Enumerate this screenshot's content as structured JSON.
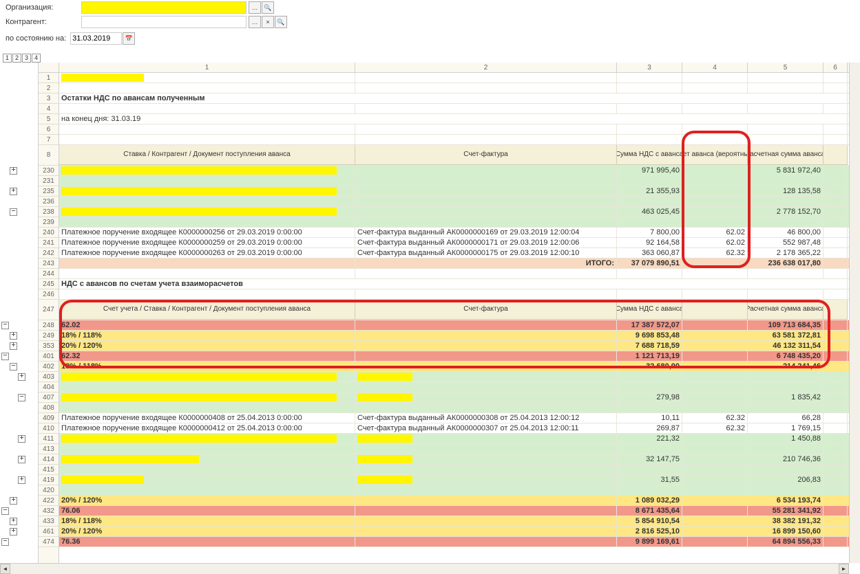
{
  "controls": {
    "org_label": "Организация:",
    "contr_label": "Контрагент:",
    "date_label": "по состоянию на:",
    "date_value": "31.03.2019",
    "btn_dots": "…",
    "btn_x": "×",
    "btn_search": "🔍",
    "btn_cal": "📅"
  },
  "outline": [
    "1",
    "2",
    "3",
    "4"
  ],
  "cols": [
    "1",
    "2",
    "3",
    "4",
    "5",
    "6"
  ],
  "title": "Остатки НДС по авансам полученным",
  "subtitle": "на конец дня: 31.03.19",
  "hdr1": {
    "c1": "Ставка / Контрагент / Документ поступления аванса",
    "c2": "Счет-фактура",
    "c3": "Сумма НДС с аванса",
    "c4": "Счет аванса (вероятный)",
    "c5": "Расчетная сумма аванса"
  },
  "rows1": [
    {
      "n": "230",
      "cls": "bg-green",
      "c1r": "rw2",
      "c3": "971 995,40",
      "c5": "5 831 972,40"
    },
    {
      "n": "231",
      "cls": "bg-green"
    },
    {
      "n": "235",
      "cls": "bg-green",
      "c1r": "rw2",
      "c3": "21 355,93",
      "c5": "128 135,58"
    },
    {
      "n": "236",
      "cls": "bg-green"
    },
    {
      "n": "238",
      "cls": "bg-green",
      "c1r": "rw2",
      "c3": "463 025,45",
      "c5": "2 778 152,70"
    },
    {
      "n": "239",
      "cls": "bg-green"
    },
    {
      "n": "240",
      "c1": "Платежное поручение входящее К0000000256 от 29.03.2019 0:00:00",
      "c2": "Счет-фактура выданный АК0000000169 от 29.03.2019 12:00:04",
      "c3": "7 800,00",
      "c4": "62.02",
      "c5": "46 800,00"
    },
    {
      "n": "241",
      "c1": "Платежное поручение входящее К0000000259 от 29.03.2019 0:00:00",
      "c2": "Счет-фактура выданный АК0000000171 от 29.03.2019 12:00:06",
      "c3": "92 164,58",
      "c4": "62.02",
      "c5": "552 987,48"
    },
    {
      "n": "242",
      "c1": "Платежное поручение входящее К0000000263 от 29.03.2019 0:00:00",
      "c2": "Счет-фактура выданный АК0000000175 от 29.03.2019 12:00:10",
      "c3": "363 060,87",
      "c4": "62.32",
      "c5": "2 178 365,22"
    },
    {
      "n": "243",
      "cls": "bg-salmon bold",
      "c2r": "ИТОГО:",
      "c3": "37 079 890,51",
      "c5": "236 638 017,80"
    }
  ],
  "title2": "НДС с авансов по счетам учета взаиморасчетов",
  "hdr2": {
    "c1": "Счет учета / Ставка / Контрагент / Документ поступления аванса",
    "c2": "Счет-фактура",
    "c3": "Сумма НДС с аванса",
    "c5": "Расчетная сумма аванса"
  },
  "rows2": [
    {
      "n": "248",
      "cls": "bg-red bold",
      "c1": "62.02",
      "c3": "17 387 572,07",
      "c5": "109 713 684,35"
    },
    {
      "n": "249",
      "cls": "bg-yel bold",
      "c1": "18% / 118%",
      "c3": "9 698 853,48",
      "c5": "63 581 372,81"
    },
    {
      "n": "353",
      "cls": "bg-yel bold",
      "c1": "20% / 120%",
      "c3": "7 688 718,59",
      "c5": "46 132 311,54"
    },
    {
      "n": "401",
      "cls": "bg-red bold",
      "c1": "62.32",
      "c3": "1 121 713,19",
      "c5": "6 748 435,20"
    },
    {
      "n": "402",
      "cls": "bg-yel bold",
      "c1": "18% / 118%",
      "c3": "32 680,90",
      "c5": "214 241,46"
    },
    {
      "n": "403",
      "cls": "bg-green",
      "c1r": "rw2",
      "c2r2": "rw4"
    },
    {
      "n": "404",
      "cls": "bg-green"
    },
    {
      "n": "407",
      "cls": "bg-green",
      "c1r": "rw2",
      "c2r2": "rw4",
      "c3": "279,98",
      "c5": "1 835,42"
    },
    {
      "n": "408",
      "cls": "bg-green"
    },
    {
      "n": "409",
      "c1": "Платежное поручение входящее К0000000408 от 25.04.2013 0:00:00",
      "c2": "Счет-фактура выданный АК0000000308 от 25.04.2013 12:00:12",
      "c3": "10,11",
      "c4": "62.32",
      "c5": "66,28"
    },
    {
      "n": "410",
      "c1": "Платежное поручение входящее К0000000412 от 25.04.2013 0:00:00",
      "c2": "Счет-фактура выданный АК0000000307 от 25.04.2013 12:00:11",
      "c3": "269,87",
      "c4": "62.32",
      "c5": "1 769,15"
    },
    {
      "n": "411",
      "cls": "bg-green",
      "c1r": "rw2",
      "c2r2": "rw4",
      "c3": "221,32",
      "c5": "1 450,88"
    },
    {
      "n": "413",
      "cls": "bg-green"
    },
    {
      "n": "414",
      "cls": "bg-green",
      "c1r": "rw1",
      "c2r2": "rw4",
      "c3": "32 147,75",
      "c5": "210 746,36"
    },
    {
      "n": "415",
      "cls": "bg-green"
    },
    {
      "n": "419",
      "cls": "bg-green",
      "c1r": "rw3",
      "c2r2": "rw4",
      "c3": "31,55",
      "c5": "206,83"
    },
    {
      "n": "420",
      "cls": "bg-green"
    },
    {
      "n": "422",
      "cls": "bg-yel bold",
      "c1": "20% / 120%",
      "c3": "1 089 032,29",
      "c5": "6 534 193,74"
    },
    {
      "n": "432",
      "cls": "bg-red bold",
      "c1": "76.06",
      "c3": "8 671 435,64",
      "c5": "55 281 341,92"
    },
    {
      "n": "433",
      "cls": "bg-yel bold",
      "c1": "18% / 118%",
      "c3": "5 854 910,54",
      "c5": "38 382 191,32"
    },
    {
      "n": "461",
      "cls": "bg-yel bold",
      "c1": "20% / 120%",
      "c3": "2 816 525,10",
      "c5": "16 899 150,60"
    },
    {
      "n": "474",
      "cls": "bg-red bold",
      "c1": "76.36",
      "c3": "9 899 169,61",
      "c5": "64 894 556,33"
    }
  ],
  "rownums_top": [
    "1",
    "2",
    "3",
    "4",
    "5",
    "6",
    "7"
  ],
  "rownums_mid": [
    "244",
    "245",
    "246"
  ]
}
